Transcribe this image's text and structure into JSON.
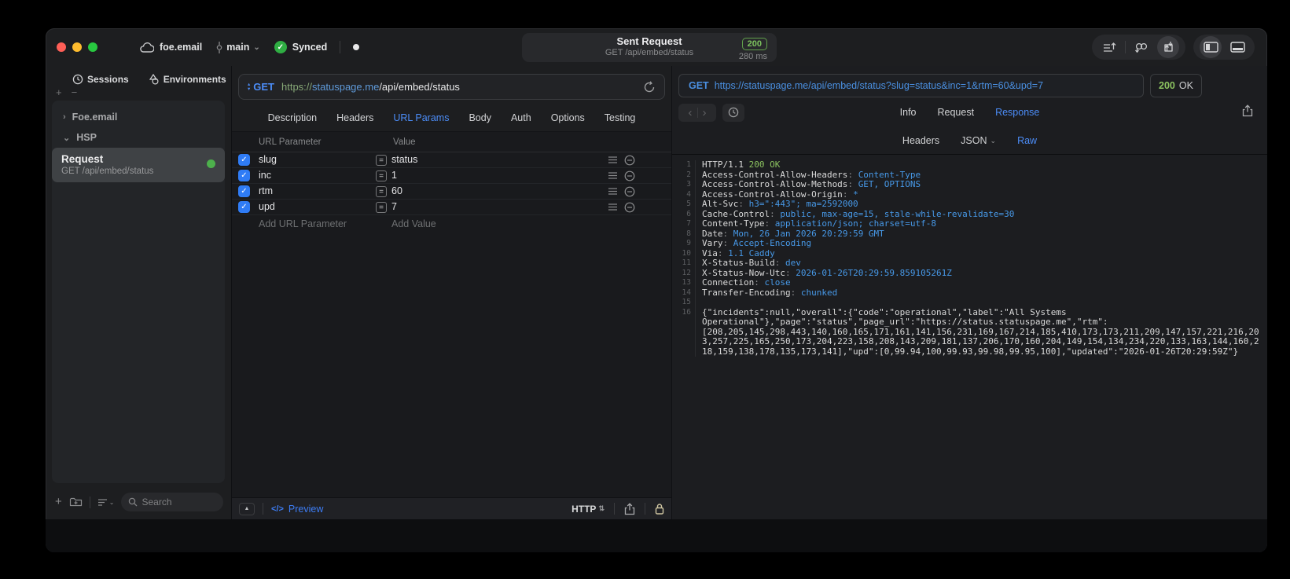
{
  "icons": {
    "collapse": "▲",
    "equals": "=",
    "stepper": "⇅",
    "back": "‹",
    "forward": "›",
    "chevron_down": "⌄",
    "chevron_right": "›",
    "plus": "+",
    "minus": "−",
    "code": "</>",
    "check": "✓",
    "tri_up": "▴",
    "tri_down": "▾"
  },
  "titlebar": {
    "project": "foe.email",
    "branch": "main",
    "sync": "Synced",
    "request_summary": {
      "title": "Sent Request",
      "subtitle": "GET /api/embed/status",
      "status": "200",
      "time": "280 ms"
    }
  },
  "sidebar": {
    "tabs": [
      {
        "label": "Sessions"
      },
      {
        "label": "Environments"
      }
    ],
    "groups": [
      {
        "label": "Foe.email"
      },
      {
        "label": "HSP"
      }
    ],
    "request_item": {
      "title": "Request",
      "subtitle": "GET /api/embed/status"
    },
    "search_placeholder": "Search"
  },
  "request": {
    "method": "GET",
    "url": {
      "scheme": "https://",
      "host": "statuspage.me",
      "path": "/api/embed/status"
    },
    "tabs": [
      "Description",
      "Headers",
      "URL Params",
      "Body",
      "Auth",
      "Options",
      "Testing"
    ],
    "active_tab": "URL Params",
    "params": {
      "col_name": "URL Parameter",
      "col_value": "Value",
      "rows": [
        {
          "name": "slug",
          "value": "status",
          "enabled": true
        },
        {
          "name": "inc",
          "value": "1",
          "enabled": true
        },
        {
          "name": "rtm",
          "value": "60",
          "enabled": true
        },
        {
          "name": "upd",
          "value": "7",
          "enabled": true
        }
      ],
      "add_name": "Add URL Parameter",
      "add_value": "Add Value"
    },
    "footer": {
      "preview_label": "Preview",
      "protocol": "HTTP"
    }
  },
  "response": {
    "request_line": {
      "method": "GET",
      "url": "https://statuspage.me/api/embed/status?slug=status&inc=1&rtm=60&upd=7"
    },
    "status_code": "200",
    "status_text": "OK",
    "tabs": [
      "Info",
      "Request",
      "Response"
    ],
    "active_tab": "Response",
    "subtabs": [
      "Headers",
      "JSON",
      "Raw"
    ],
    "active_subtab": "Raw",
    "raw_lines": [
      {
        "n": "1",
        "parts": [
          [
            "h",
            "HTTP/1.1 "
          ],
          [
            "g",
            "200 OK"
          ]
        ]
      },
      {
        "n": "2",
        "parts": [
          [
            "n",
            "Access-Control-Allow-Headers"
          ],
          [
            "p",
            ": "
          ],
          [
            "v",
            "Content-Type"
          ]
        ]
      },
      {
        "n": "3",
        "parts": [
          [
            "n",
            "Access-Control-Allow-Methods"
          ],
          [
            "p",
            ": "
          ],
          [
            "v",
            "GET, OPTIONS"
          ]
        ]
      },
      {
        "n": "4",
        "parts": [
          [
            "n",
            "Access-Control-Allow-Origin"
          ],
          [
            "p",
            ": "
          ],
          [
            "v",
            "*"
          ]
        ]
      },
      {
        "n": "5",
        "parts": [
          [
            "n",
            "Alt-Svc"
          ],
          [
            "p",
            ": "
          ],
          [
            "v",
            "h3=\":443\"; ma=2592000"
          ]
        ]
      },
      {
        "n": "6",
        "parts": [
          [
            "n",
            "Cache-Control"
          ],
          [
            "p",
            ": "
          ],
          [
            "v",
            "public, max-age=15, stale-while-revalidate=30"
          ]
        ]
      },
      {
        "n": "7",
        "parts": [
          [
            "n",
            "Content-Type"
          ],
          [
            "p",
            ": "
          ],
          [
            "v",
            "application/json; charset=utf-8"
          ]
        ]
      },
      {
        "n": "8",
        "parts": [
          [
            "n",
            "Date"
          ],
          [
            "p",
            ": "
          ],
          [
            "v",
            "Mon, 26 Jan 2026 20:29:59 GMT"
          ]
        ]
      },
      {
        "n": "9",
        "parts": [
          [
            "n",
            "Vary"
          ],
          [
            "p",
            ": "
          ],
          [
            "v",
            "Accept-Encoding"
          ]
        ]
      },
      {
        "n": "10",
        "parts": [
          [
            "n",
            "Via"
          ],
          [
            "p",
            ": "
          ],
          [
            "v",
            "1.1 Caddy"
          ]
        ]
      },
      {
        "n": "11",
        "parts": [
          [
            "n",
            "X-Status-Build"
          ],
          [
            "p",
            ": "
          ],
          [
            "v",
            "dev"
          ]
        ]
      },
      {
        "n": "12",
        "parts": [
          [
            "n",
            "X-Status-Now-Utc"
          ],
          [
            "p",
            ": "
          ],
          [
            "v",
            "2026-01-26T20:29:59.859105261Z"
          ]
        ]
      },
      {
        "n": "13",
        "parts": [
          [
            "n",
            "Connection"
          ],
          [
            "p",
            ": "
          ],
          [
            "v",
            "close"
          ]
        ]
      },
      {
        "n": "14",
        "parts": [
          [
            "n",
            "Transfer-Encoding"
          ],
          [
            "p",
            ": "
          ],
          [
            "v",
            "chunked"
          ]
        ]
      },
      {
        "n": "15",
        "parts": []
      },
      {
        "n": "16",
        "parts": [
          [
            "h",
            "{\"incidents\":null,\"overall\":{\"code\":\"operational\",\"label\":\"All Systems Operational\"},\"page\":\"status\",\"page_url\":\"https://status.statuspage.me\",\"rtm\":[208,205,145,298,443,140,160,165,171,161,141,156,231,169,167,214,185,410,173,173,211,209,147,157,221,216,203,257,225,165,250,173,204,223,158,208,143,209,181,137,206,170,160,204,149,154,134,234,220,133,163,144,160,218,159,138,178,135,173,141],\"upd\":[0,99.94,100,99.93,99.98,99.95,100],\"updated\":\"2026-01-26T20:29:59Z\"}"
          ]
        ]
      }
    ]
  }
}
